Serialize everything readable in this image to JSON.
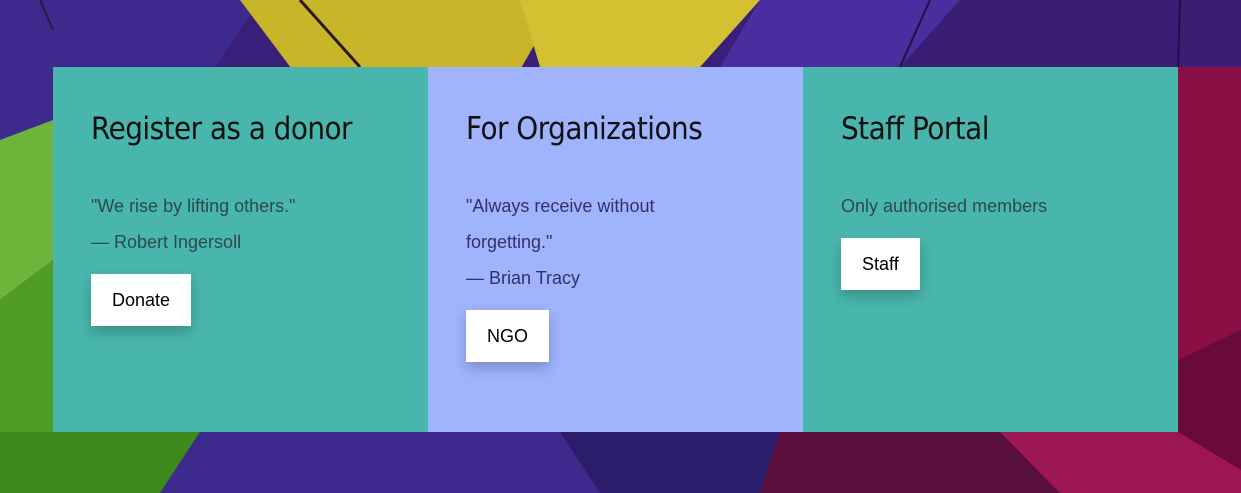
{
  "cards": [
    {
      "title": "Register as a donor",
      "quote": "\"We rise by lifting others.\"",
      "author": "— Robert Ingersoll",
      "button_label": "Donate",
      "color": "#48b6ac"
    },
    {
      "title": "For Organizations",
      "quote": "\"Always receive without forgetting.\"",
      "author": "— Brian Tracy",
      "button_label": "NGO",
      "color": "#a0b3fd"
    },
    {
      "title": "Staff Portal",
      "text": "Only authorised members",
      "button_label": "Staff",
      "color": "#48b6ac"
    }
  ]
}
